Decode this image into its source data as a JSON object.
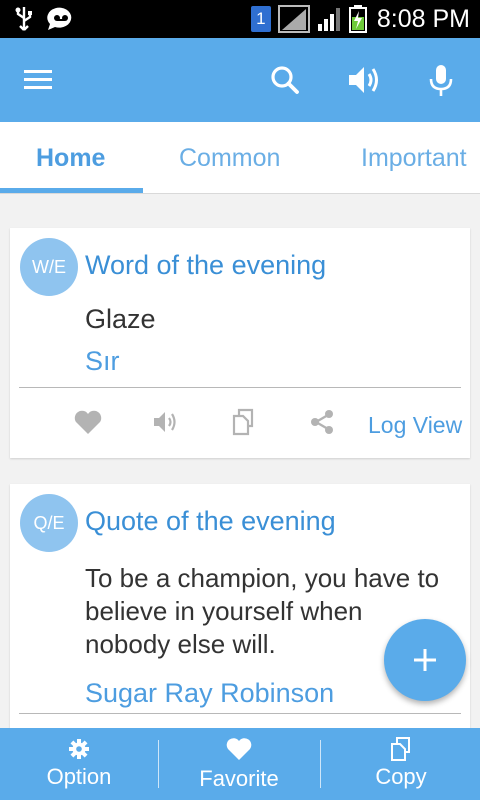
{
  "status_bar": {
    "time": "8:08 PM",
    "sim_slot": "1"
  },
  "app_bar": {
    "icons": [
      "menu-icon",
      "search-icon",
      "speaker-icon",
      "microphone-icon"
    ]
  },
  "tabs": [
    {
      "label": "Home",
      "active": true
    },
    {
      "label": "Common",
      "active": false
    },
    {
      "label": "Important",
      "active": false
    }
  ],
  "word_card": {
    "badge": "W/E",
    "title": "Word of the evening",
    "word": "Glaze",
    "meaning": "Sır",
    "actions": [
      "heart-icon",
      "speaker-icon",
      "copy-icon",
      "share-icon"
    ],
    "log_view": "Log View"
  },
  "quote_card": {
    "badge": "Q/E",
    "title": "Quote of the evening",
    "quote": "To be a champion, you have to believe in yourself when nobody else will.",
    "author": "Sugar Ray Robinson"
  },
  "fab": {
    "icon": "plus-icon"
  },
  "bottom_bar": {
    "items": [
      {
        "label": "Option",
        "icon": "gear-icon"
      },
      {
        "label": "Favorite",
        "icon": "heart-icon"
      },
      {
        "label": "Copy",
        "icon": "copy-icon"
      }
    ]
  },
  "colors": {
    "primary": "#5aabea",
    "accent_text": "#4d9de0",
    "badge": "#8fc4ef"
  }
}
